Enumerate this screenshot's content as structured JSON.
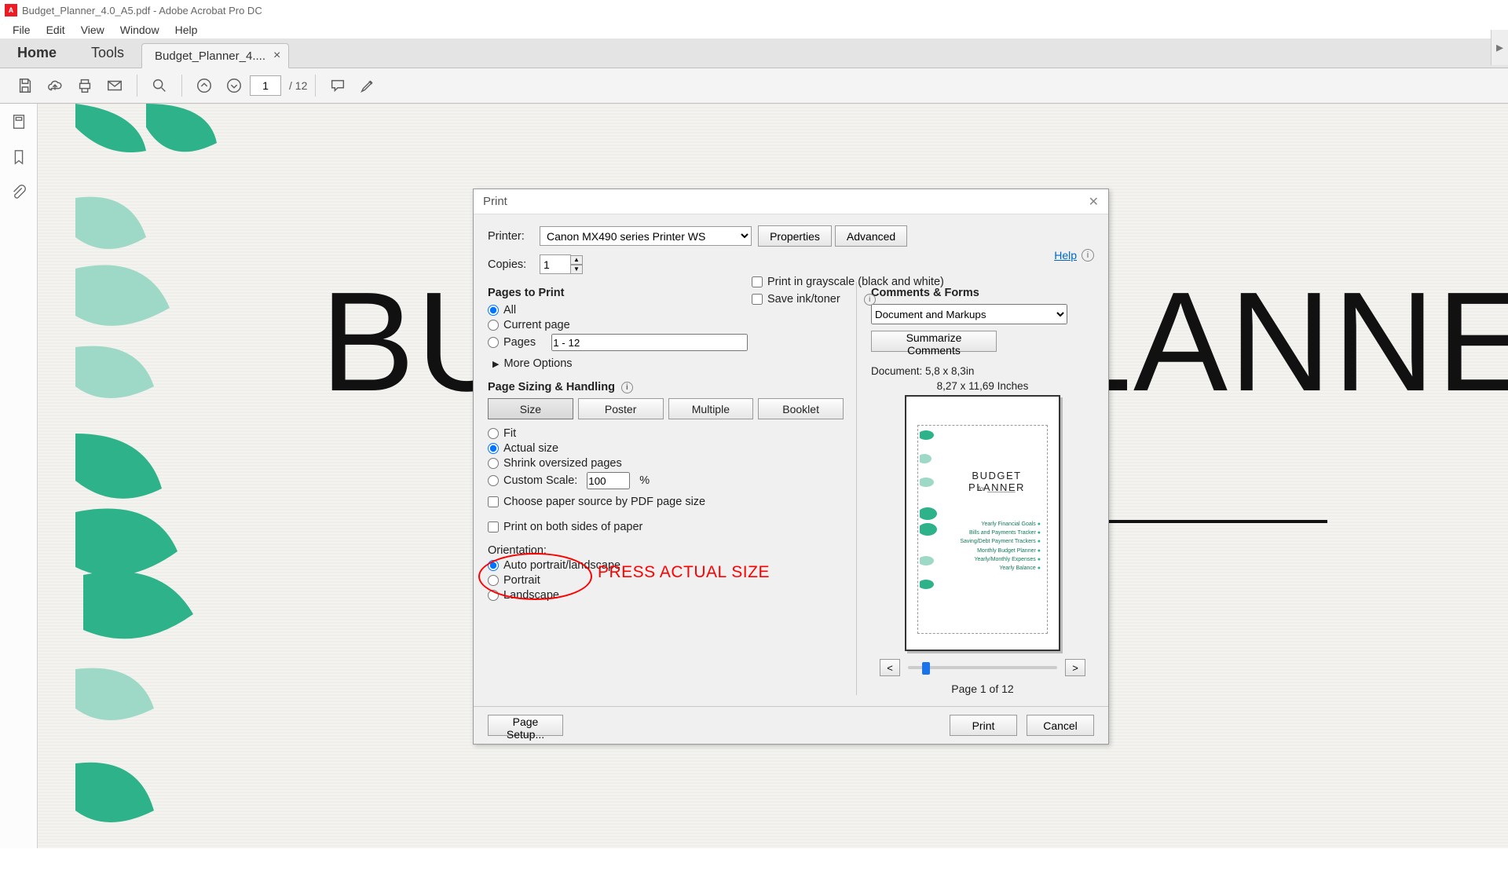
{
  "window": {
    "title": "Budget_Planner_4.0_A5.pdf - Adobe Acrobat Pro DC"
  },
  "menubar": {
    "file": "File",
    "edit": "Edit",
    "view": "View",
    "window": "Window",
    "help": "Help"
  },
  "tabs": {
    "home": "Home",
    "tools": "Tools",
    "doc": "Budget_Planner_4...."
  },
  "toolbar": {
    "page_current": "1",
    "page_sep": "/",
    "page_total": "12"
  },
  "document": {
    "title": "BUDGET PLANNER",
    "for_label": "for"
  },
  "dialog": {
    "title": "Print",
    "printer_label": "Printer:",
    "printer_value": "Canon MX490 series Printer WS",
    "properties": "Properties",
    "advanced": "Advanced",
    "help": "Help",
    "copies_label": "Copies:",
    "copies_value": "1",
    "grayscale": "Print in grayscale (black and white)",
    "save_ink": "Save ink/toner",
    "pages_to_print": "Pages to Print",
    "all": "All",
    "current_page": "Current page",
    "pages": "Pages",
    "pages_range": "1 - 12",
    "more_options": "More Options",
    "page_sizing": "Page Sizing & Handling",
    "seg_size": "Size",
    "seg_poster": "Poster",
    "seg_multiple": "Multiple",
    "seg_booklet": "Booklet",
    "fit": "Fit",
    "actual_size": "Actual size",
    "shrink": "Shrink oversized pages",
    "custom_scale": "Custom Scale:",
    "custom_scale_value": "100",
    "custom_scale_pct": "%",
    "choose_paper": "Choose paper source by PDF page size",
    "both_sides": "Print on both sides of paper",
    "orientation": "Orientation:",
    "auto_orient": "Auto portrait/landscape",
    "portrait": "Portrait",
    "landscape": "Landscape",
    "comments_forms": "Comments & Forms",
    "comments_value": "Document and Markups",
    "summarize": "Summarize Comments",
    "doc_dims": "Document: 5,8 x 8,3in",
    "paper_dims": "8,27 x 11,69 Inches",
    "preview_title": "BUDGET PLANNER",
    "preview_for": "for ________",
    "preview_list": [
      "Yearly Financial Goals",
      "Bills and Payments Tracker",
      "Saving/Debt Payment Trackers",
      "Monthly Budget Planner",
      "Yearly/Monthly Expenses",
      "Yearly Balance"
    ],
    "prev": "<",
    "next": ">",
    "page_of": "Page 1 of 12",
    "page_setup": "Page Setup...",
    "print": "Print",
    "cancel": "Cancel"
  },
  "annotation": {
    "text": "PRESS ACTUAL SIZE"
  }
}
